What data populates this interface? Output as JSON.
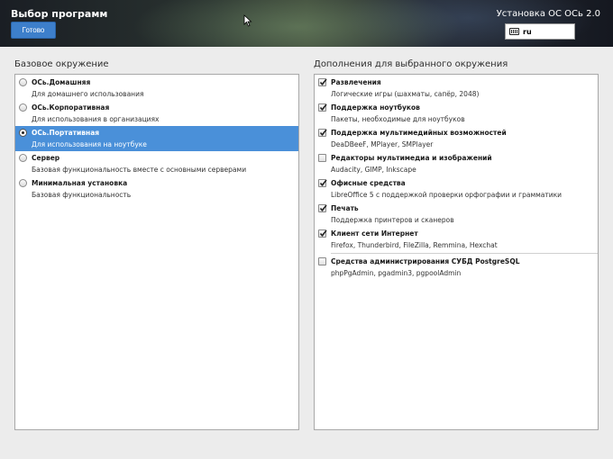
{
  "header": {
    "title": "Выбор программ",
    "done_label": "Готово",
    "product_title": "Установка ОС ОСь 2.0",
    "keyboard_layout": "ru"
  },
  "base_environment": {
    "label": "Базовое окружение",
    "items": [
      {
        "title": "ОСь.Домашняя",
        "desc": "Для домашнего использования",
        "selected": false
      },
      {
        "title": "ОСь.Корпоративная",
        "desc": "Для использования в организациях",
        "selected": false
      },
      {
        "title": "ОСь.Портативная",
        "desc": "Для использования на ноутбуке",
        "selected": true
      },
      {
        "title": "Сервер",
        "desc": "Базовая функциональность вместе с основными серверами",
        "selected": false
      },
      {
        "title": "Минимальная установка",
        "desc": "Базовая функциональность",
        "selected": false
      }
    ]
  },
  "addons": {
    "label": "Дополнения для выбранного окружения",
    "items": [
      {
        "title": "Развлечения",
        "desc": "Логические игры (шахматы, сапёр, 2048)",
        "checked": true
      },
      {
        "title": "Поддержка ноутбуков",
        "desc": "Пакеты, необходимые для ноутбуков",
        "checked": true
      },
      {
        "title": "Поддержка мультимедийных возможностей",
        "desc": "DeaDBeeF, MPlayer, SMPlayer",
        "checked": true
      },
      {
        "title": "Редакторы мультимедиа и изображений",
        "desc": "Audacity, GIMP, Inkscape",
        "checked": false
      },
      {
        "title": "Офисные средства",
        "desc": "LibreOffice 5 с поддержкой проверки орфографии и грамматики",
        "checked": true
      },
      {
        "title": "Печать",
        "desc": "Поддержка принтеров и сканеров",
        "checked": true
      },
      {
        "title": "Клиент сети Интернет",
        "desc": "Firefox, Thunderbird, FileZilla, Remmina, Hexchat",
        "checked": true
      },
      {
        "title": "Средства администрирования СУБД PostgreSQL",
        "desc": "phpPgAdmin, pgadmin3, pgpoolAdmin",
        "checked": false
      }
    ]
  },
  "colors": {
    "accent": "#4a90d9",
    "button": "#3d7fcb"
  }
}
